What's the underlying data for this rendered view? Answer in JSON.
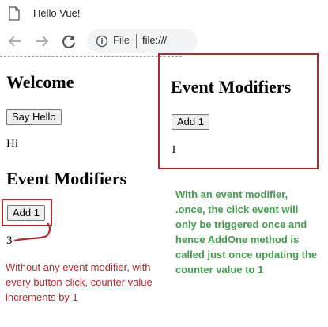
{
  "browser": {
    "tab_title": "Hello Vue!",
    "omnibox_scheme": "File",
    "omnibox_url": "file:///"
  },
  "left_page": {
    "welcome_heading": "Welcome",
    "say_hello_button": "Say Hello",
    "greeting_text": "Hi",
    "modifiers_heading": "Event Modifiers",
    "add_button": "Add 1",
    "counter_value": "3"
  },
  "right_page": {
    "modifiers_heading": "Event Modifiers",
    "add_button": "Add 1",
    "counter_value": "1"
  },
  "annotations": {
    "once_note": "With an event modifier, .once, the click event will only be triggered once and hence AddOne method is called just once updating the counter value to 1",
    "no_modifier_note": "Without any event modifier, with every button click, counter value increments by 1"
  },
  "colors": {
    "annotation_red": "#b7272c",
    "annotation_green": "#3f9d4c"
  }
}
